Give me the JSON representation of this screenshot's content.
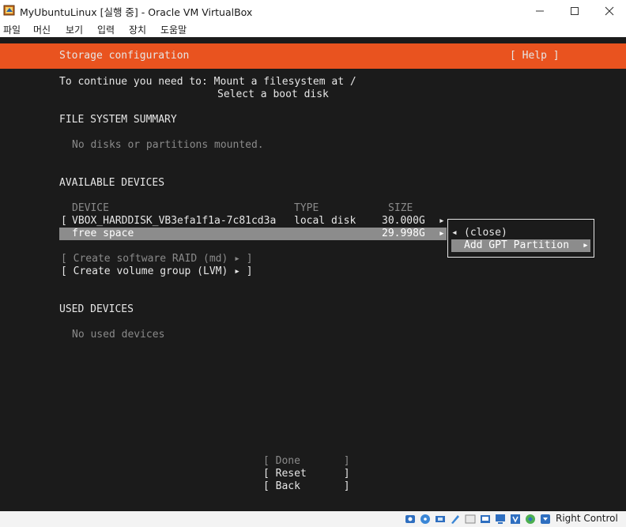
{
  "window": {
    "title": "MyUbuntuLinux [실행 중] - Oracle VM VirtualBox",
    "minimize": "—",
    "maximize": "☐",
    "close": "✕"
  },
  "menu": [
    "파일",
    "머신",
    "보기",
    "입력",
    "장치",
    "도움말"
  ],
  "installer": {
    "header_title": "Storage configuration",
    "help_button": "[ Help ]",
    "intro_line1": "To continue you need to: Mount a filesystem at /",
    "intro_line2": "Select a boot disk",
    "fs_summary_heading": "FILE SYSTEM SUMMARY",
    "fs_summary_empty": "No disks or partitions mounted.",
    "available_heading": "AVAILABLE DEVICES",
    "columns": {
      "device": "DEVICE",
      "type": "TYPE",
      "size": "SIZE"
    },
    "disk_row": {
      "bracket": "[",
      "device": "VBOX_HARDDISK_VB3efa1f1a-7c81cd3a",
      "type": "local disk",
      "size": "30.000G",
      "arrow": "▸"
    },
    "free_row": {
      "device": "free space",
      "size": "29.998G",
      "arrow": "▸"
    },
    "create_raid": "[ Create software RAID (md) ▸ ]",
    "create_lvm": "[ Create volume group (LVM) ▸ ]",
    "used_heading": "USED DEVICES",
    "used_empty": "No used devices",
    "popup": {
      "close_arrow": "◂",
      "close_label": "(close)",
      "add_gpt_label": "Add GPT Partition",
      "add_gpt_arrow": "▸"
    },
    "buttons": {
      "done": "[ Done       ]",
      "reset": "[ Reset      ]",
      "back": "[ Back       ]"
    }
  },
  "statusbar": {
    "host_key": "Right Control"
  }
}
